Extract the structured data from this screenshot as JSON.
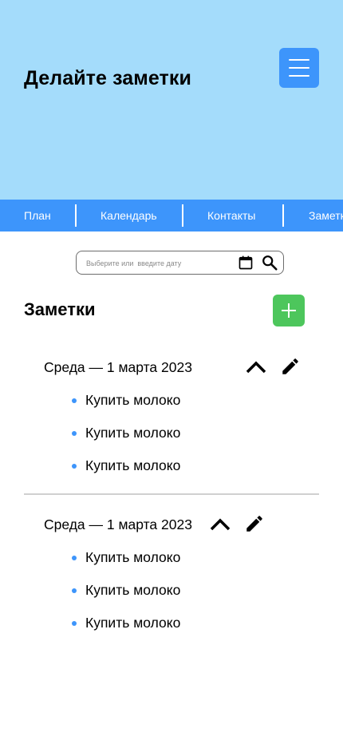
{
  "header": {
    "title": "Делайте заметки",
    "menu_icon": "hamburger-menu-icon",
    "background_color": "#a4dcfb",
    "accent_color": "#3d95fb"
  },
  "nav": {
    "items": [
      {
        "label": "План"
      },
      {
        "label": "Календарь"
      },
      {
        "label": "Контакты"
      },
      {
        "label": "Заметки"
      }
    ]
  },
  "date_picker": {
    "placeholder": "Выберите или  введите дату",
    "value": "",
    "calendar_icon": "calendar-icon",
    "search_icon": "search-icon"
  },
  "notes_section": {
    "title": "Заметки",
    "add_icon": "plus-icon",
    "add_button_color": "#4dc65c"
  },
  "notes": [
    {
      "date": "Среда — 1 марта 2023",
      "collapse_icon": "chevron-up-icon",
      "edit_icon": "pencil-icon",
      "items": [
        "Купить молоко",
        "Купить молоко",
        "Купить молоко"
      ]
    },
    {
      "date": "Среда — 1 марта 2023",
      "collapse_icon": "chevron-up-icon",
      "edit_icon": "pencil-icon",
      "items": [
        "Купить молоко",
        "Купить молоко",
        "Купить молоко"
      ]
    }
  ]
}
